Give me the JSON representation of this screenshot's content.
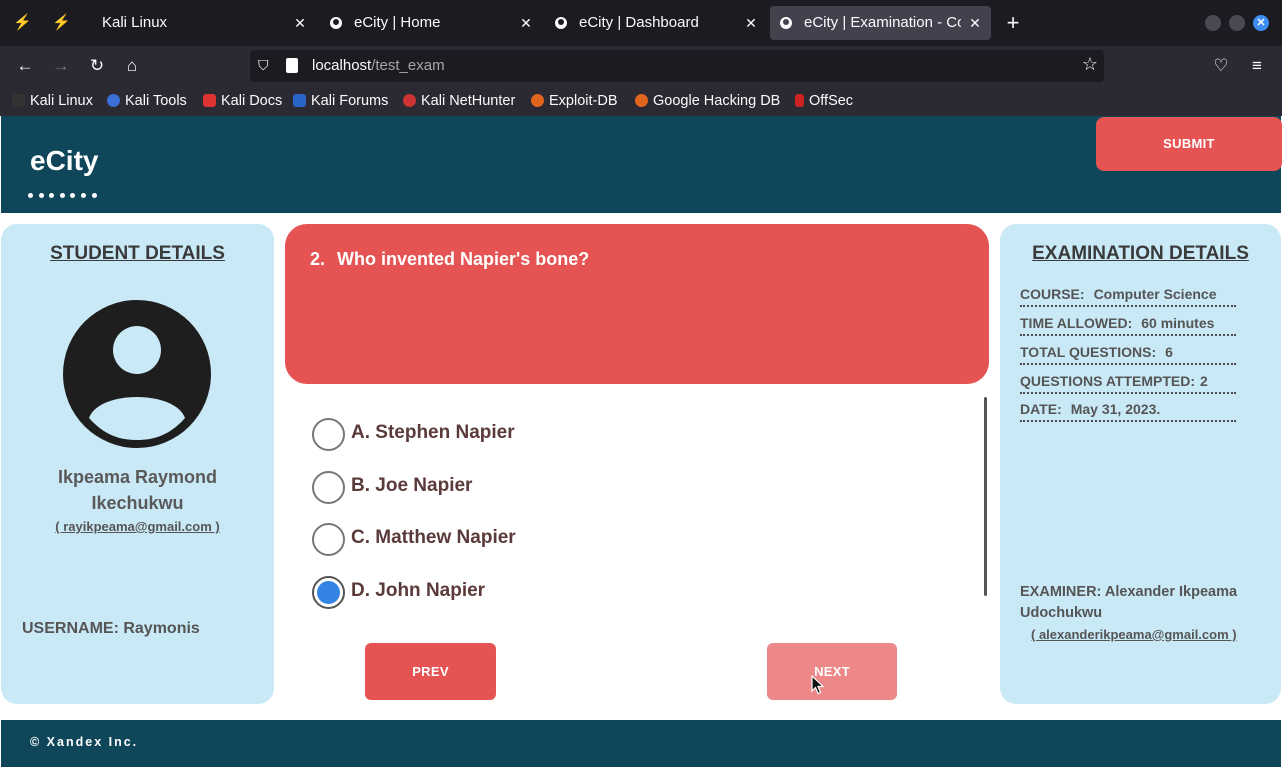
{
  "browser": {
    "tabs": [
      {
        "title": "Kali Linux",
        "active": false,
        "has_icon": false
      },
      {
        "title": "eCity | Home",
        "active": false,
        "has_icon": true
      },
      {
        "title": "eCity | Dashboard",
        "active": false,
        "has_icon": true
      },
      {
        "title": "eCity | Examination - Co",
        "active": true,
        "has_icon": true
      }
    ],
    "url_host": "localhost",
    "url_path": "/test_exam",
    "bookmarks": [
      "Kali Linux",
      "Kali Tools",
      "Kali Docs",
      "Kali Forums",
      "Kali NetHunter",
      "Exploit-DB",
      "Google Hacking DB",
      "OffSec"
    ]
  },
  "header": {
    "logo": "eCity",
    "submit_label": "SUBMIT"
  },
  "student": {
    "title": "STUDENT DETAILS",
    "name": "Ikpeama Raymond Ikechukwu",
    "email": "( rayikpeama@gmail.com )",
    "username_label": "USERNAME:",
    "username": "Raymonis"
  },
  "question": {
    "number": "2.",
    "text": "Who invented Napier's bone?",
    "options": [
      {
        "label": "A. Stephen Napier",
        "checked": false
      },
      {
        "label": "B. Joe Napier",
        "checked": false
      },
      {
        "label": "C. Matthew Napier",
        "checked": false
      },
      {
        "label": "D. John Napier",
        "checked": true
      }
    ],
    "prev_label": "PREV",
    "next_label": "NEXT"
  },
  "exam": {
    "title": "EXAMINATION DETAILS",
    "rows": [
      {
        "label": "COURSE:",
        "value": "Computer Science"
      },
      {
        "label": "TIME ALLOWED:",
        "value": "60 minutes"
      },
      {
        "label": "TOTAL QUESTIONS:",
        "value": "6"
      },
      {
        "label": "QUESTIONS ATTEMPTED:",
        "value": "2"
      },
      {
        "label": "DATE:",
        "value": "May 31, 2023."
      }
    ],
    "examiner_label": "EXAMINER:",
    "examiner_name": "Alexander Ikpeama Udochukwu",
    "examiner_email": "( alexanderikpeama@gmail.com )"
  },
  "footer": {
    "text": "© Xandex Inc."
  },
  "colors": {
    "header_bg": "#0f4659",
    "accent_red": "#e55353",
    "panel_bg": "#c9e9f7",
    "radio_checked": "#3584e4"
  }
}
